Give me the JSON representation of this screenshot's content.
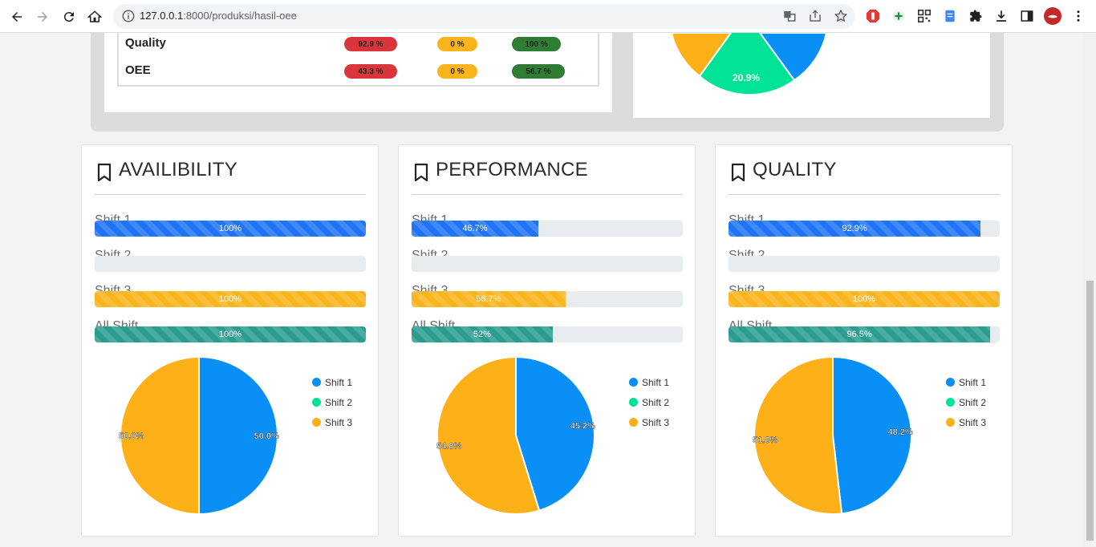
{
  "browser": {
    "url_host": "127.0.0.1",
    "url_path": ":8000/produksi/hasil-oee"
  },
  "summary_table": {
    "rows": [
      {
        "label": "Quality",
        "values": [
          "92.9 %",
          "0 %",
          "100 %"
        ]
      },
      {
        "label": "OEE",
        "values": [
          "43.3 %",
          "0 %",
          "56.7 %"
        ]
      }
    ]
  },
  "top_pie": {
    "label": "20.9%"
  },
  "colors": {
    "shift1": "#0a8ff7",
    "shift2": "#00e396",
    "shift3": "#feb019"
  },
  "legend": [
    "Shift 1",
    "Shift 2",
    "Shift 3"
  ],
  "cards": [
    {
      "title": "AVAILIBILITY",
      "bars": [
        {
          "label": "Shift 1",
          "text": "100%",
          "value": 100,
          "color": "blue"
        },
        {
          "label": "Shift 2",
          "text": "",
          "value": 0,
          "color": "blue"
        },
        {
          "label": "Shift 3",
          "text": "100%",
          "value": 100,
          "color": "yellow"
        },
        {
          "label": "All Shift",
          "text": "100%",
          "value": 100,
          "color": "teal"
        }
      ],
      "pie": [
        {
          "name": "Shift 1",
          "value": 50.0,
          "label": "50.0%"
        },
        {
          "name": "Shift 2",
          "value": 0,
          "label": ""
        },
        {
          "name": "Shift 3",
          "value": 50.0,
          "label": "50.0%"
        }
      ]
    },
    {
      "title": "PERFORMANCE",
      "bars": [
        {
          "label": "Shift 1",
          "text": "46.7%",
          "value": 46.7,
          "color": "blue"
        },
        {
          "label": "Shift 2",
          "text": "",
          "value": 0,
          "color": "blue"
        },
        {
          "label": "Shift 3",
          "text": "56.7%",
          "value": 56.7,
          "color": "yellow"
        },
        {
          "label": "All Shift",
          "text": "52%",
          "value": 52,
          "color": "teal"
        }
      ],
      "pie": [
        {
          "name": "Shift 1",
          "value": 45.2,
          "label": "45.2%"
        },
        {
          "name": "Shift 2",
          "value": 0,
          "label": ""
        },
        {
          "name": "Shift 3",
          "value": 54.8,
          "label": "54.8%"
        }
      ]
    },
    {
      "title": "QUALITY",
      "bars": [
        {
          "label": "Shift 1",
          "text": "92.9%",
          "value": 92.9,
          "color": "blue"
        },
        {
          "label": "Shift 2",
          "text": "",
          "value": 0,
          "color": "blue"
        },
        {
          "label": "Shift 3",
          "text": "100%",
          "value": 100,
          "color": "yellow"
        },
        {
          "label": "All Shift",
          "text": "96.5%",
          "value": 96.5,
          "color": "teal"
        }
      ],
      "pie": [
        {
          "name": "Shift 1",
          "value": 48.2,
          "label": "48.2%"
        },
        {
          "name": "Shift 2",
          "value": 0,
          "label": ""
        },
        {
          "name": "Shift 3",
          "value": 51.8,
          "label": "51.8%"
        }
      ]
    }
  ]
}
